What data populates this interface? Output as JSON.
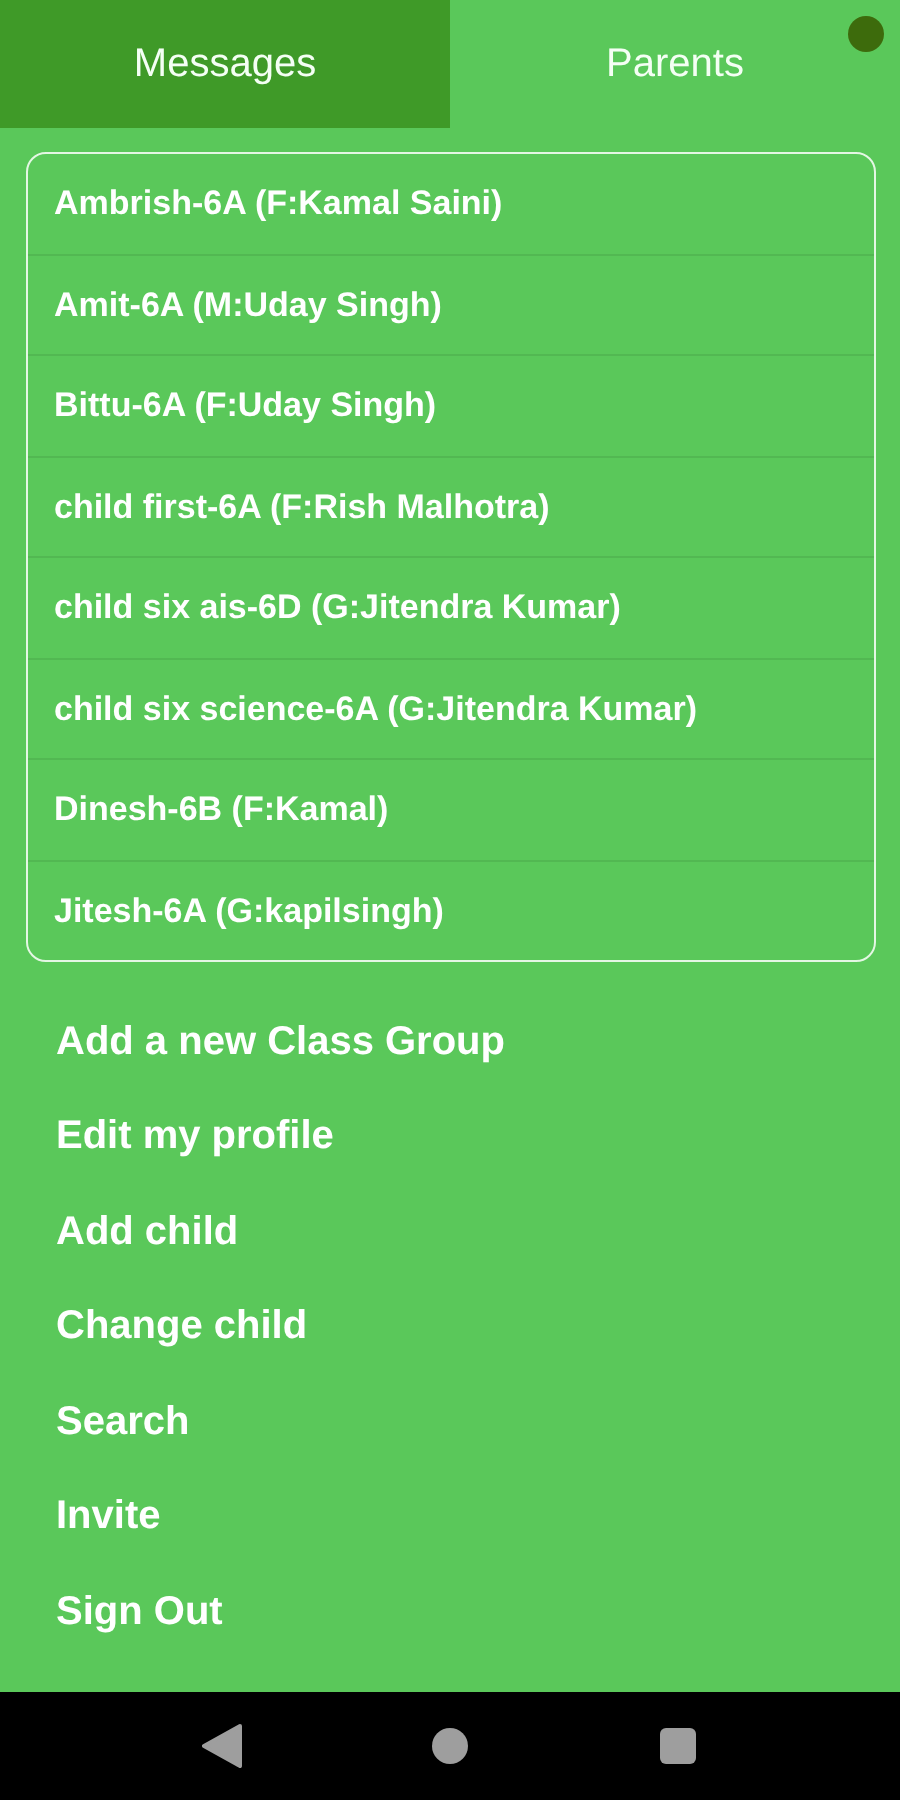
{
  "tabs": [
    {
      "label": "Messages",
      "selected": false
    },
    {
      "label": "Parents",
      "selected": true
    }
  ],
  "parents": [
    "Ambrish-6A (F:Kamal Saini)",
    "Amit-6A (M:Uday Singh)",
    "Bittu-6A (F:Uday Singh)",
    "child first-6A (F:Rish Malhotra)",
    "child six ais-6D (G:Jitendra Kumar)",
    "child six science-6A (G:Jitendra Kumar)",
    "Dinesh-6B (F:Kamal)",
    "Jitesh-6A (G:kapilsingh)"
  ],
  "menu": [
    "Add a new Class Group",
    "Edit my profile",
    "Add child",
    "Change child",
    "Search",
    "Invite",
    "Sign Out"
  ]
}
